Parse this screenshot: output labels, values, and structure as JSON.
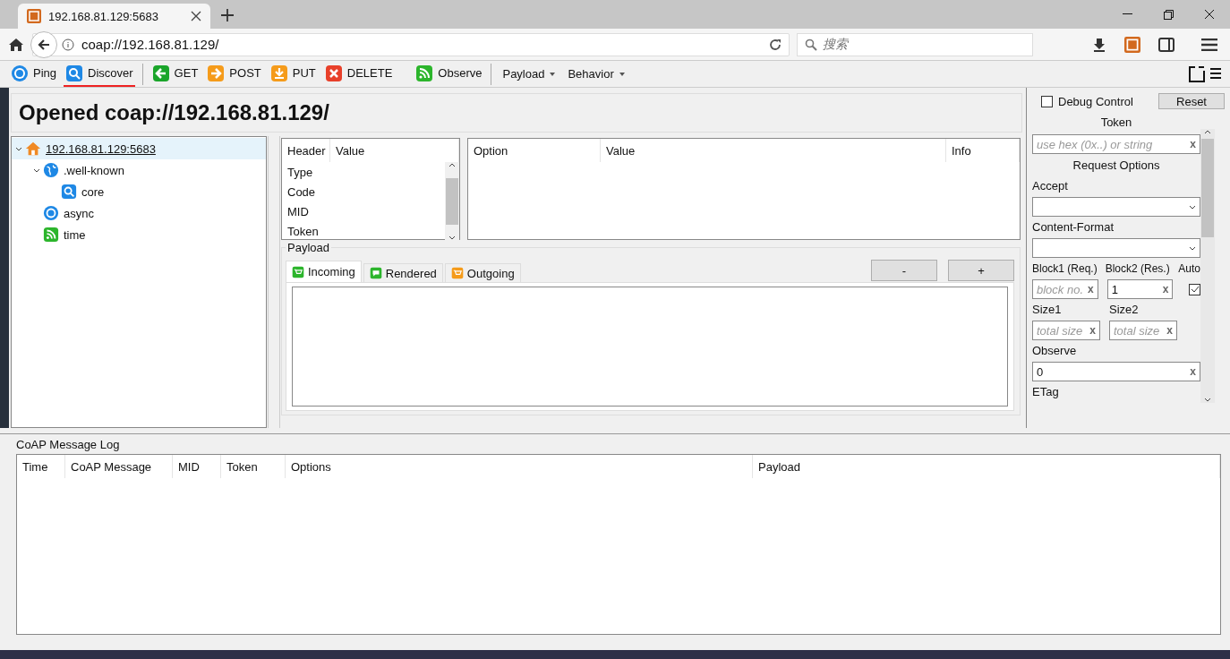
{
  "browser": {
    "tab_title": "192.168.81.129:5683",
    "address": "coap://192.168.81.129/",
    "search_placeholder": "搜索"
  },
  "toolbar": {
    "items": [
      {
        "label": "Ping",
        "selected": false
      },
      {
        "label": "Discover",
        "selected": true
      },
      {
        "label": "GET",
        "selected": false
      },
      {
        "label": "POST",
        "selected": false
      },
      {
        "label": "PUT",
        "selected": false
      },
      {
        "label": "DELETE",
        "selected": false
      },
      {
        "label": "Observe",
        "selected": false
      }
    ],
    "menus": [
      "Payload",
      "Behavior"
    ]
  },
  "title": "Opened coap://192.168.81.129/",
  "tree": [
    {
      "label": "192.168.81.129:5683",
      "selected": true,
      "expanded": true,
      "children": [
        {
          "label": ".well-known",
          "selected": false,
          "expanded": true,
          "children": [
            {
              "label": "core",
              "selected": false
            }
          ]
        },
        {
          "label": "async",
          "selected": false
        },
        {
          "label": "time",
          "selected": false
        }
      ]
    }
  ],
  "header_table": {
    "columns": [
      "Header",
      "Value"
    ],
    "rows": [
      "Type",
      "Code",
      "MID",
      "Token"
    ]
  },
  "options_table": {
    "columns": [
      "Option",
      "Value",
      "Info"
    ]
  },
  "payload": {
    "label": "Payload",
    "tabs": [
      {
        "label": "Incoming",
        "selected": true
      },
      {
        "label": "Rendered",
        "selected": false
      },
      {
        "label": "Outgoing",
        "selected": false
      }
    ],
    "buttons": [
      "-",
      "+"
    ]
  },
  "debug": {
    "label": "Debug Control",
    "checked": false,
    "reset": "Reset",
    "token_label": "Token",
    "token": {
      "placeholder": "use hex (0x..) or string",
      "clear": "x"
    },
    "request_title": "Request Options",
    "accept": "Accept",
    "content_format": "Content-Format",
    "block1": {
      "label": "Block1 (Req.)",
      "placeholder": "block no.",
      "clear": "x"
    },
    "block2": {
      "label": "Block2 (Res.)",
      "value": "1",
      "clear": "x"
    },
    "auto": {
      "label": "Auto",
      "checked": true
    },
    "size1": {
      "label": "Size1",
      "placeholder": "total size",
      "clear": "x"
    },
    "size2": {
      "label": "Size2",
      "placeholder": "total size",
      "clear": "x"
    },
    "observe": {
      "label": "Observe",
      "value": "0",
      "clear": "x"
    },
    "etag": "ETag"
  },
  "log": {
    "title": "CoAP Message Log",
    "columns": [
      "Time",
      "CoAP Message",
      "MID",
      "Token",
      "Options",
      "Payload"
    ]
  }
}
